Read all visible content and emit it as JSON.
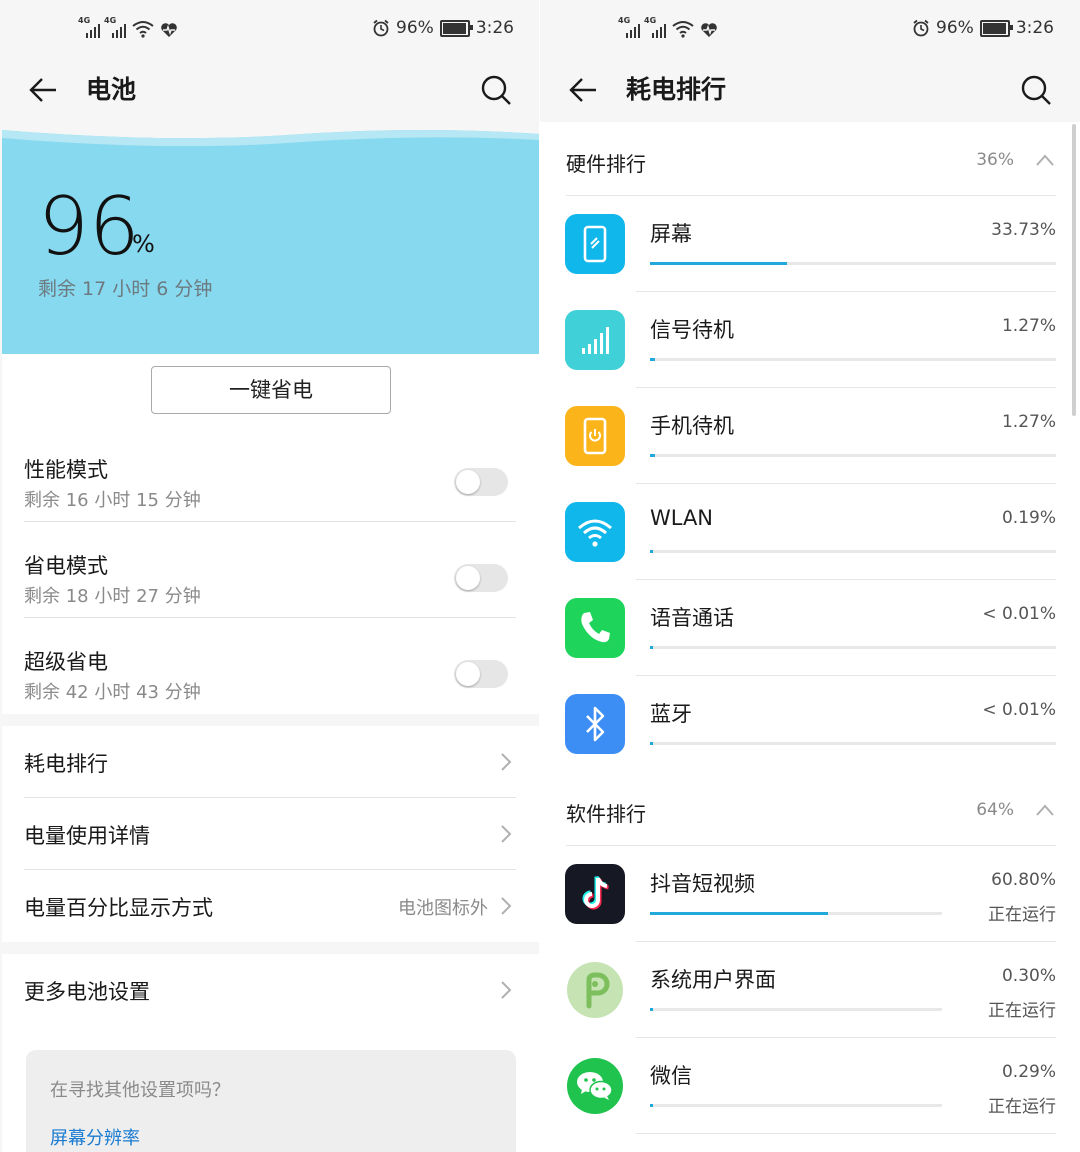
{
  "status_bar": {
    "network_left": "4G",
    "network_right": "4G",
    "battery_percent": "96%",
    "time": "3:26"
  },
  "battery_screen": {
    "title": "电池",
    "level": "96",
    "level_unit": "%",
    "remaining": "剩余 17 小时 6 分钟",
    "save_button": "一键省电",
    "modes": [
      {
        "title": "性能模式",
        "subtitle": "剩余 16 小时 15 分钟",
        "on": false
      },
      {
        "title": "省电模式",
        "subtitle": "剩余 18 小时 27 分钟",
        "on": false
      },
      {
        "title": "超级省电",
        "subtitle": "剩余 42 小时 43 分钟",
        "on": false
      }
    ],
    "nav_items": [
      {
        "title": "耗电排行",
        "value": ""
      },
      {
        "title": "电量使用详情",
        "value": ""
      },
      {
        "title": "电量百分比显示方式",
        "value": "电池图标外"
      }
    ],
    "more_settings": "更多电池设置",
    "suggest_question": "在寻找其他设置项吗？",
    "suggest_link": "屏幕分辨率"
  },
  "ranking_screen": {
    "title": "耗电排行",
    "hardware_header": "硬件排行",
    "hardware_percent": "36%",
    "hardware_items": [
      {
        "name": "屏幕",
        "value": "33.73%",
        "fraction": 0.3373,
        "icon": "screen-icon",
        "color": "#10b7ea"
      },
      {
        "name": "信号待机",
        "value": "1.27%",
        "fraction": 0.0127,
        "icon": "signal-icon",
        "color": "#3fd0d8"
      },
      {
        "name": "手机待机",
        "value": "1.27%",
        "fraction": 0.0127,
        "icon": "phone-standby-icon",
        "color": "#fbb51b"
      },
      {
        "name": "WLAN",
        "value": "0.19%",
        "fraction": 0.0019,
        "icon": "wifi-icon",
        "color": "#10b7ea"
      },
      {
        "name": "语音通话",
        "value": "< 0.01%",
        "fraction": 0.0001,
        "icon": "phone-call-icon",
        "color": "#1ed45a"
      },
      {
        "name": "蓝牙",
        "value": "< 0.01%",
        "fraction": 0.0001,
        "icon": "bluetooth-icon",
        "color": "#3c8ef5"
      }
    ],
    "software_header": "软件排行",
    "software_percent": "64%",
    "software_items": [
      {
        "name": "抖音短视频",
        "value": "60.80%",
        "status": "正在运行",
        "fraction": 0.608,
        "icon": "tiktok-icon"
      },
      {
        "name": "系统用户界面",
        "value": "0.30%",
        "status": "正在运行",
        "fraction": 0.003,
        "icon": "android-p-icon"
      },
      {
        "name": "微信",
        "value": "0.29%",
        "status": "正在运行",
        "fraction": 0.0029,
        "icon": "wechat-icon"
      }
    ]
  },
  "colors": {
    "accent": "#22a9dc",
    "battery_hero": "#87d9ef",
    "link": "#1a7bd1"
  }
}
